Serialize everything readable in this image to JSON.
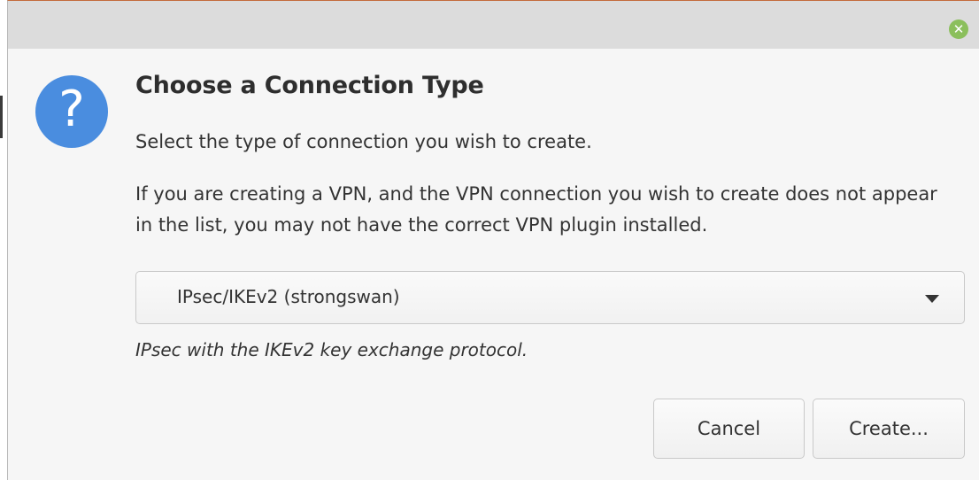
{
  "dialog": {
    "title": "Choose a Connection Type",
    "close_icon": "close-icon",
    "question_icon": "question-icon",
    "question_glyph": "?",
    "description": "Select the type of connection you wish to create.",
    "vpn_note": "If you are creating a VPN, and the VPN connection you wish to create does not appear in the list, you may not have the correct VPN plugin installed.",
    "connection_type": {
      "selected": "IPsec/IKEv2 (strongswan)",
      "selected_description": "IPsec with the IKEv2 key exchange protocol."
    },
    "buttons": {
      "cancel_label": "Cancel",
      "create_label": "Create..."
    },
    "colors": {
      "close_button": "#8bbf5c",
      "question_icon": "#4a8ddf",
      "titlebar": "#dcdcdc",
      "background": "#f6f6f6"
    }
  }
}
